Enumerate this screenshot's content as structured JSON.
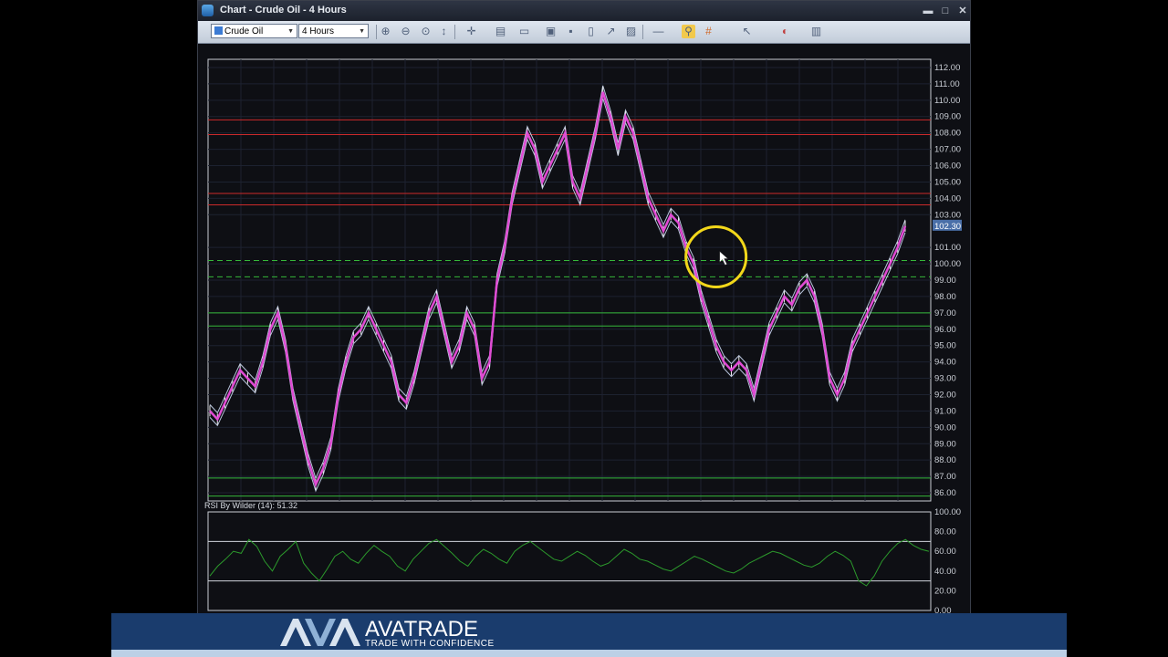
{
  "window": {
    "title": "Chart - Crude Oil - 4 Hours",
    "controls": {
      "minimize": "▬",
      "maximize": "□",
      "close": "✕"
    }
  },
  "toolbar": {
    "symbol": "Crude Oil",
    "timeframe": "4 Hours",
    "icons": [
      "zoom-in-icon",
      "zoom-out-icon",
      "zoom-fit-icon",
      "scale-icon",
      "crosshair-icon",
      "chart-type-icon",
      "print-icon",
      "save-icon",
      "page-icon",
      "indicator-icon",
      "template-icon",
      "line-tool-icon",
      "link-icon",
      "grid-icon",
      "cursor-icon",
      "color-icon",
      "settings-icon"
    ]
  },
  "price_axis": {
    "ticks": [
      "112.00",
      "111.00",
      "110.00",
      "109.00",
      "108.00",
      "107.00",
      "106.00",
      "105.00",
      "104.00",
      "103.00",
      "102.30",
      "101.00",
      "100.00",
      "99.00",
      "98.00",
      "97.00",
      "96.00",
      "95.00",
      "94.00",
      "93.00",
      "92.00",
      "91.00",
      "90.00",
      "89.00",
      "88.00",
      "87.00",
      "86.00"
    ],
    "current_price": "102.30"
  },
  "rsi_panel": {
    "label": "RSI By Wilder (14): 51.32",
    "ticks": [
      "100.00",
      "80.00",
      "60.00",
      "40.00",
      "20.00",
      "0.00"
    ]
  },
  "colors": {
    "background": "#0e0f14",
    "price_line": "#e04bd4",
    "resistance": "#cc2a2a",
    "support": "#35b83a",
    "rsi_line": "#2c9a2c",
    "highlight_circle": "#f2d71a"
  },
  "chart_data": [
    {
      "type": "line",
      "title": "Crude Oil - 4 Hours",
      "ylim": [
        85.5,
        112.5
      ],
      "series": [
        {
          "values": [
            91,
            90.5,
            91.5,
            92.5,
            93.5,
            93,
            92.5,
            94,
            96,
            97,
            95,
            92,
            90,
            88,
            86.5,
            87.5,
            89,
            92,
            94,
            95.5,
            96,
            97,
            96,
            95,
            94,
            92,
            91.5,
            93,
            95,
            97,
            98,
            96,
            94,
            95,
            97,
            96,
            93,
            94,
            99,
            101,
            104,
            106,
            108,
            107,
            105,
            106,
            107,
            108,
            105,
            104,
            106,
            108,
            110.5,
            109,
            107,
            109,
            108,
            106,
            104,
            103,
            102,
            103,
            102.5,
            101,
            100,
            98,
            96.5,
            95,
            94,
            93.5,
            94,
            93.5,
            92,
            94,
            96,
            97,
            98,
            97.5,
            98.5,
            99,
            98,
            96,
            93,
            92,
            93,
            95,
            96,
            97,
            98,
            99,
            100,
            101,
            102.3
          ]
        },
        {
          "values": [
            109.5,
            109.5,
            109.5,
            109.5,
            109.5,
            109.5,
            109.5,
            109.5,
            109.5,
            109.5,
            109.5,
            109.5,
            109.5,
            109.5,
            109.5,
            109.5,
            109.5,
            109.5,
            109.5,
            109.5,
            109.5,
            109.5,
            109.5,
            109.5,
            109.5,
            109.5,
            109.5,
            109.5,
            109.5,
            109.5,
            109.5,
            109.5,
            109.5,
            109.5,
            109.5,
            109.5,
            109.5,
            109.5,
            109.5,
            109.5,
            109.5,
            109.5,
            109.5,
            109.5,
            109.5,
            109.5,
            109.5,
            109.5,
            109.5,
            109.5,
            109.5,
            109.5,
            109.5,
            109.5,
            109.5,
            109.5,
            109.5,
            109.5,
            109.5,
            109.5,
            109.5,
            109.5,
            109.5,
            109.5,
            109.5,
            109.5,
            109.5,
            109.5,
            109.5,
            109.5,
            109.5,
            109.5,
            109.5,
            109.5,
            109.5,
            109.5,
            109.5,
            109.5,
            109.5,
            109.5,
            109.5,
            109.5,
            109.5,
            109.5,
            109.5,
            109.5,
            109.5,
            109.5,
            109.5,
            109.5,
            109.5,
            109.5,
            109.5
          ]
        }
      ],
      "levels": {
        "resistance": [
          108.8,
          107.9,
          104.3,
          103.6
        ],
        "support_dashed": [
          100.2,
          99.2
        ],
        "support": [
          97.0,
          96.2,
          86.9,
          85.8
        ]
      }
    },
    {
      "type": "line",
      "title": "RSI By Wilder (14): 51.32",
      "ylim": [
        0,
        100
      ],
      "levels": [
        70,
        30
      ],
      "series": [
        {
          "values": [
            35,
            45,
            52,
            60,
            58,
            72,
            65,
            50,
            40,
            55,
            62,
            70,
            48,
            38,
            30,
            42,
            55,
            60,
            52,
            48,
            58,
            66,
            60,
            55,
            45,
            40,
            52,
            60,
            68,
            72,
            65,
            58,
            50,
            45,
            55,
            62,
            58,
            52,
            48,
            60,
            66,
            70,
            64,
            58,
            52,
            50,
            55,
            60,
            56,
            50,
            45,
            48,
            55,
            62,
            58,
            52,
            50,
            46,
            42,
            40,
            45,
            50,
            55,
            52,
            48,
            44,
            40,
            38,
            42,
            48,
            52,
            56,
            60,
            58,
            54,
            50,
            46,
            44,
            48,
            55,
            60,
            56,
            50,
            30,
            25,
            35,
            50,
            60,
            68,
            72,
            66,
            62,
            60
          ]
        }
      ]
    }
  ],
  "brand": {
    "logo_text": "AVA",
    "name": "AVATRADE",
    "tagline": "TRADE WITH CONFIDENCE"
  }
}
